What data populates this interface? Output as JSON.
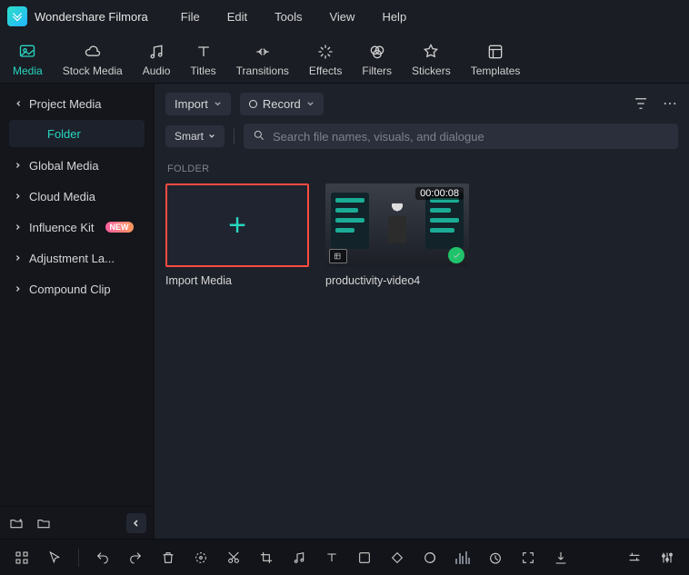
{
  "app": {
    "title": "Wondershare Filmora"
  },
  "menu": [
    "File",
    "Edit",
    "Tools",
    "View",
    "Help"
  ],
  "top_tabs": [
    {
      "label": "Media",
      "active": true
    },
    {
      "label": "Stock Media"
    },
    {
      "label": "Audio"
    },
    {
      "label": "Titles"
    },
    {
      "label": "Transitions"
    },
    {
      "label": "Effects"
    },
    {
      "label": "Filters"
    },
    {
      "label": "Stickers"
    },
    {
      "label": "Templates"
    }
  ],
  "sidebar": {
    "items": [
      {
        "label": "Project Media",
        "expanded": true
      },
      {
        "label": "Global Media"
      },
      {
        "label": "Cloud Media"
      },
      {
        "label": "Influence Kit",
        "badge": "NEW"
      },
      {
        "label": "Adjustment La..."
      },
      {
        "label": "Compound Clip"
      }
    ],
    "sub_selected": "Folder"
  },
  "content_toolbar": {
    "import_label": "Import",
    "record_label": "Record"
  },
  "sort_label": "Smart",
  "search": {
    "placeholder": "Search file names, visuals, and dialogue"
  },
  "section_label": "FOLDER",
  "cards": [
    {
      "type": "import",
      "label": "Import Media"
    },
    {
      "type": "video",
      "label": "productivity-video4",
      "duration": "00:00:08"
    }
  ]
}
